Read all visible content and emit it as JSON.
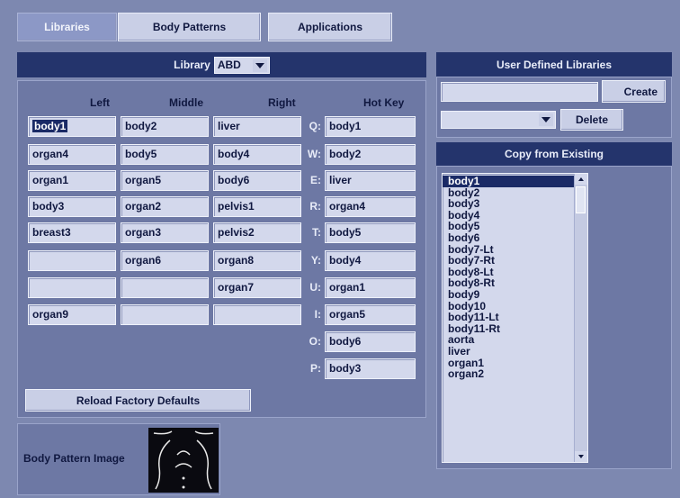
{
  "tabs": [
    {
      "label": "Libraries"
    },
    {
      "label": "Body Patterns"
    },
    {
      "label": "Applications"
    }
  ],
  "library": {
    "label": "Library",
    "selected": "ABD"
  },
  "columns": {
    "left": "Left",
    "middle": "Middle",
    "right": "Right",
    "hotkey": "Hot Key"
  },
  "grid": {
    "left": [
      "body1",
      "organ4",
      "organ1",
      "body3",
      "breast3",
      "",
      "",
      "organ9"
    ],
    "middle": [
      "body2",
      "body5",
      "organ5",
      "organ2",
      "organ3",
      "organ6",
      "",
      ""
    ],
    "right": [
      "liver",
      "body4",
      "body6",
      "pelvis1",
      "pelvis2",
      "organ8",
      "organ7",
      ""
    ]
  },
  "hotkeys": [
    {
      "key": "Q:",
      "value": "body1"
    },
    {
      "key": "W:",
      "value": "body2"
    },
    {
      "key": "E:",
      "value": "liver"
    },
    {
      "key": "R:",
      "value": "organ4"
    },
    {
      "key": "T:",
      "value": "body5"
    },
    {
      "key": "Y:",
      "value": "body4"
    },
    {
      "key": "U:",
      "value": "organ1"
    },
    {
      "key": "I:",
      "value": "organ5"
    },
    {
      "key": "O:",
      "value": "body6"
    },
    {
      "key": "P:",
      "value": "body3"
    }
  ],
  "reload_button": "Reload Factory Defaults",
  "body_pattern_label": "Body Pattern Image",
  "user_defined": {
    "title": "User Defined Libraries",
    "name_value": "",
    "create_label": "Create",
    "select_value": "",
    "delete_label": "Delete"
  },
  "copy_existing": {
    "title": "Copy from Existing",
    "items": [
      "body1",
      "body2",
      "body3",
      "body4",
      "body5",
      "body6",
      "body7-Lt",
      "body7-Rt",
      "body8-Lt",
      "body8-Rt",
      "body9",
      "body10",
      "body11-Lt",
      "body11-Rt",
      "aorta",
      "liver",
      "organ1",
      "organ2"
    ],
    "selected_index": 0
  },
  "colors": {
    "background": "#7d88b0",
    "header": "#24346c",
    "field": "#d3d8ec",
    "selection": "#1a2a66"
  }
}
